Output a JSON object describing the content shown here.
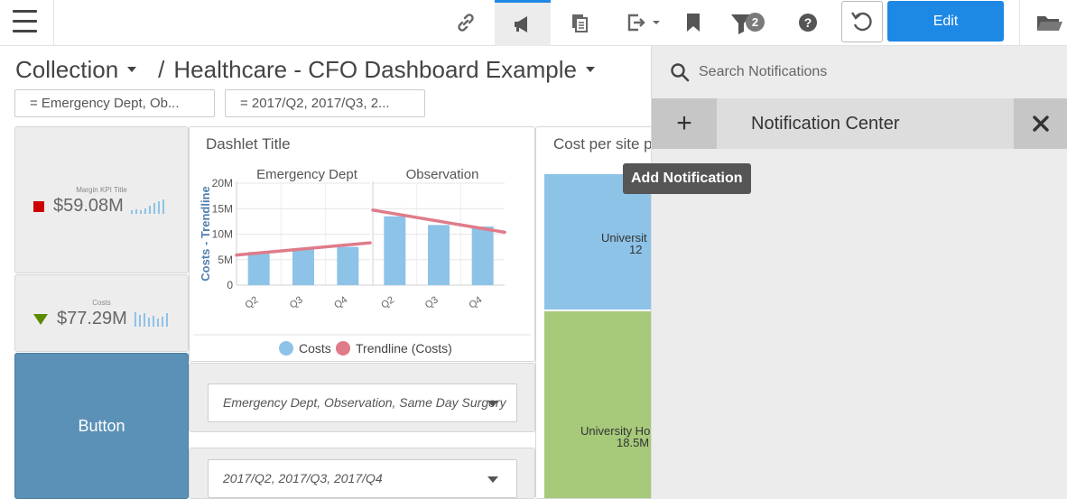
{
  "toolbar": {
    "edit_label": "Edit",
    "filter_count": "2",
    "icons": [
      "menu-icon",
      "link-icon",
      "announce-icon",
      "copy-icon",
      "export-icon",
      "bookmark-icon",
      "filter-icon",
      "help-icon",
      "refresh-icon",
      "folder-icon"
    ],
    "accent_color": "#1e88e5"
  },
  "breadcrumb": {
    "collection": "Collection",
    "separator": "/",
    "dashboard": "Healthcare - CFO Dashboard Example"
  },
  "filters": [
    {
      "label": "= Emergency Dept, Ob..."
    },
    {
      "label": "= 2017/Q2, 2017/Q3, 2..."
    }
  ],
  "kpis": [
    {
      "title": "Margin KPI Title",
      "value": "$59.08M",
      "indicator": "red-square",
      "indicator_color": "#cc0000"
    },
    {
      "title": "Costs",
      "value": "$77.29M",
      "indicator": "down-triangle",
      "indicator_color": "#5a8a00"
    }
  ],
  "button_tile": {
    "label": "Button"
  },
  "chart": {
    "title": "Dashlet Title",
    "chart_data": {
      "type": "bar",
      "panels": [
        "Emergency Dept",
        "Observation"
      ],
      "categories": [
        "Q2",
        "Q3",
        "Q4"
      ],
      "tick_labels": [
        "Q2",
        "Q3",
        "Q4"
      ],
      "ylabel": "Costs - Trendline",
      "ylim": [
        0,
        20
      ],
      "y_ticks": [
        "0",
        "5M",
        "10M",
        "15M",
        "20M"
      ],
      "y_tick_values": [
        0,
        5,
        10,
        15,
        20
      ],
      "series": [
        {
          "name": "Costs",
          "color": "#8ec3e8",
          "values": [
            [
              6.5,
              7.0,
              7.5
            ],
            [
              13.5,
              11.8,
              11.5
            ]
          ]
        },
        {
          "name": "Trendline (Costs)",
          "color": "#e07b8a",
          "type": "line",
          "values": [
            [
              6.3,
              7.2,
              7.9
            ],
            [
              14.0,
              12.5,
              11.1
            ]
          ]
        }
      ],
      "legend": "bottom"
    }
  },
  "dropdowns": [
    {
      "value": "Emergency Dept, Observation, Same Day Surgery"
    },
    {
      "value": "2017/Q2, 2017/Q3, 2017/Q4"
    }
  ],
  "treemap": {
    "title": "Cost per site p",
    "blocks": [
      {
        "label": "Universit",
        "sub": "12",
        "color": "#8ec3e8"
      },
      {
        "label": "University Ho",
        "sub": "18.5M",
        "color": "#a6c97a"
      }
    ]
  },
  "notifications": {
    "search_placeholder": "Search Notifications",
    "title": "Notification Center",
    "add_symbol": "+",
    "tooltip": "Add Notification"
  }
}
